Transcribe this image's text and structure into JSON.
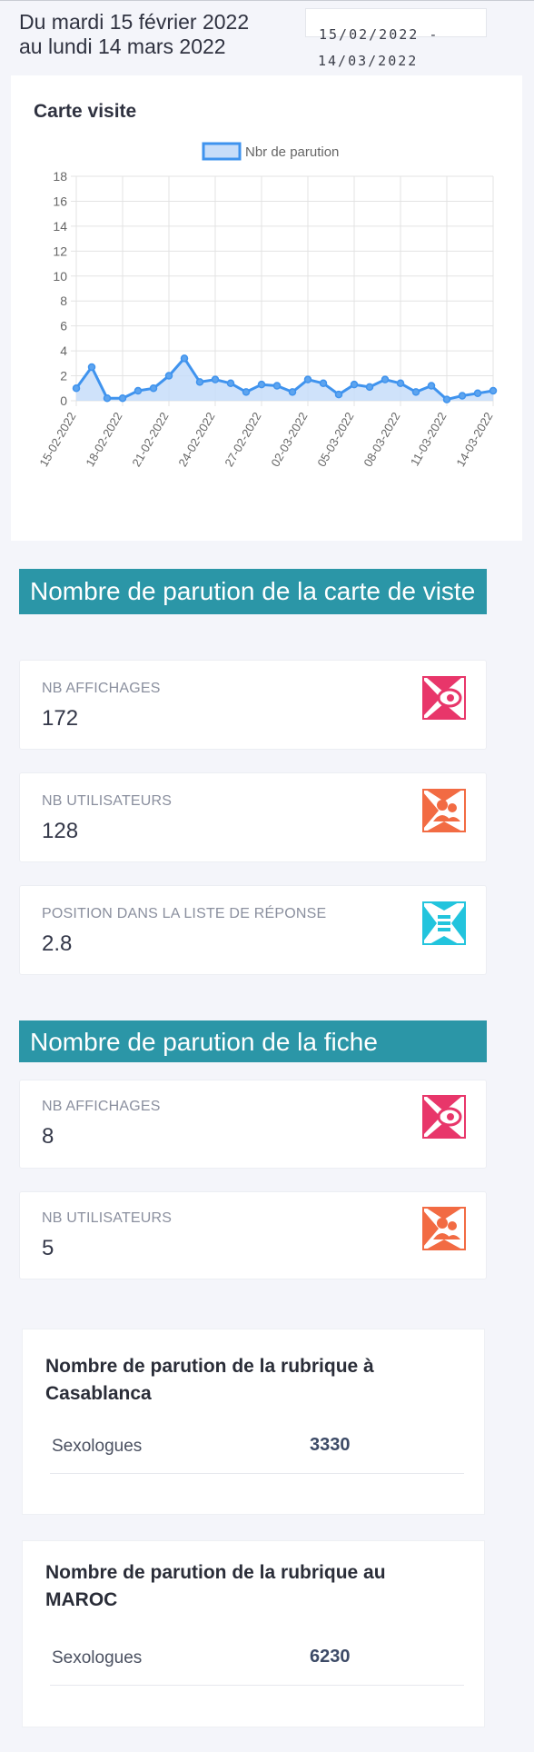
{
  "period": {
    "line1": "Du mardi 15 février 2022",
    "line2": "au lundi 14 mars 2022"
  },
  "date_range": {
    "start": "15/02/2022 -",
    "end": "14/03/2022"
  },
  "visit_card": {
    "title": "Carte visite"
  },
  "chart_data": {
    "type": "area",
    "legend": "Nbr de parution",
    "legend_position": "top",
    "grid": true,
    "ylim": [
      0,
      18
    ],
    "yticks": [
      0,
      2,
      4,
      6,
      8,
      10,
      12,
      14,
      16,
      18
    ],
    "x": [
      "15-02-2022",
      "16-02-2022",
      "17-02-2022",
      "18-02-2022",
      "19-02-2022",
      "20-02-2022",
      "21-02-2022",
      "22-02-2022",
      "23-02-2022",
      "24-02-2022",
      "25-02-2022",
      "26-02-2022",
      "27-02-2022",
      "28-02-2022",
      "01-03-2022",
      "02-03-2022",
      "03-03-2022",
      "04-03-2022",
      "05-03-2022",
      "06-03-2022",
      "07-03-2022",
      "08-03-2022",
      "09-03-2022",
      "10-03-2022",
      "11-03-2022",
      "12-03-2022",
      "13-03-2022",
      "14-03-2022"
    ],
    "xtick_labels": [
      "15-02-2022",
      "18-02-2022",
      "21-02-2022",
      "24-02-2022",
      "27-02-2022",
      "02-03-2022",
      "05-03-2022",
      "08-03-2022",
      "11-03-2022",
      "14-03-2022"
    ],
    "values": [
      1,
      2.7,
      0.2,
      0.2,
      0.8,
      1,
      2,
      3.4,
      1.5,
      1.7,
      1.4,
      0.7,
      1.3,
      1.2,
      0.7,
      1.7,
      1.4,
      0.5,
      1.3,
      1.1,
      1.7,
      1.4,
      0.7,
      1.2,
      0.1,
      0.4,
      0.6,
      0.8
    ],
    "colors": {
      "line": "#3f93ee",
      "fill": "#c7ddf9",
      "point": "#5da4ef"
    }
  },
  "section_card": {
    "title": "Nombre de parution de la carte de viste",
    "stats": [
      {
        "label": "NB AFFICHAGES",
        "value": "172",
        "icon": "eye-icon",
        "color": "#e8366a"
      },
      {
        "label": "NB UTILISATEURS",
        "value": "128",
        "icon": "users-icon",
        "color": "#f26b43"
      },
      {
        "label": "POSITION DANS LA LISTE DE RÉPONSE",
        "value": "2.8",
        "icon": "list-position-icon",
        "color": "#22c4dd"
      }
    ]
  },
  "section_fiche": {
    "title": "Nombre de parution de la fiche",
    "stats": [
      {
        "label": "NB AFFICHAGES",
        "value": "8",
        "icon": "eye-icon",
        "color": "#e8366a"
      },
      {
        "label": "NB UTILISATEURS",
        "value": "5",
        "icon": "users-icon",
        "color": "#f26b43"
      }
    ]
  },
  "rubrique_casablanca": {
    "title": "Nombre de parution de la rubrique à Casablanca",
    "rows": [
      {
        "label": "Sexologues",
        "value": "3330"
      }
    ]
  },
  "rubrique_maroc": {
    "title": "Nombre de parution de la rubrique au MAROC",
    "rows": [
      {
        "label": "Sexologues",
        "value": "6230"
      }
    ]
  }
}
